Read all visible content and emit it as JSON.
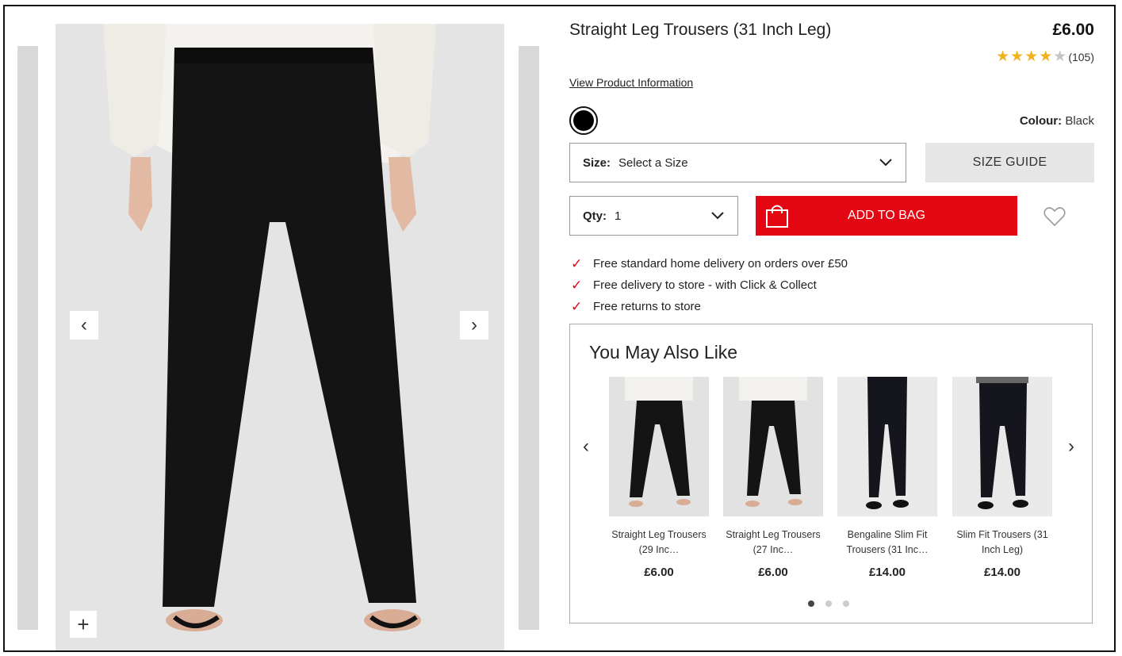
{
  "product": {
    "title": "Straight Leg Trousers (31 Inch Leg)",
    "price": "£6.00",
    "rating_value": 4,
    "rating_max": 5,
    "rating_count": "(105)",
    "view_info": "View Product Information",
    "colour_label": "Colour:",
    "colour_value": "Black",
    "swatch_color": "#000000"
  },
  "selectors": {
    "size_label": "Size:",
    "size_value": "Select a Size",
    "size_guide": "SIZE GUIDE",
    "qty_label": "Qty:",
    "qty_value": "1"
  },
  "actions": {
    "add_to_bag": "ADD TO BAG",
    "accent_color": "#e30613"
  },
  "perks": [
    "Free standard home delivery on orders over £50",
    "Free delivery to store - with Click & Collect",
    "Free returns to store"
  ],
  "gallery": {
    "zoom_symbol": "+",
    "prev_symbol": "‹",
    "next_symbol": "›"
  },
  "recommendations": {
    "title": "You May Also Like",
    "items": [
      {
        "name": "Straight Leg Trousers (29 Inc…",
        "price": "£6.00"
      },
      {
        "name": "Straight Leg Trousers (27 Inc…",
        "price": "£6.00"
      },
      {
        "name": "Bengaline Slim Fit Trousers (31 Inc…",
        "price": "£14.00"
      },
      {
        "name": "Slim Fit Trousers (31 Inch Leg)",
        "price": "£14.00"
      }
    ],
    "page_count": 3,
    "active_page": 1
  }
}
